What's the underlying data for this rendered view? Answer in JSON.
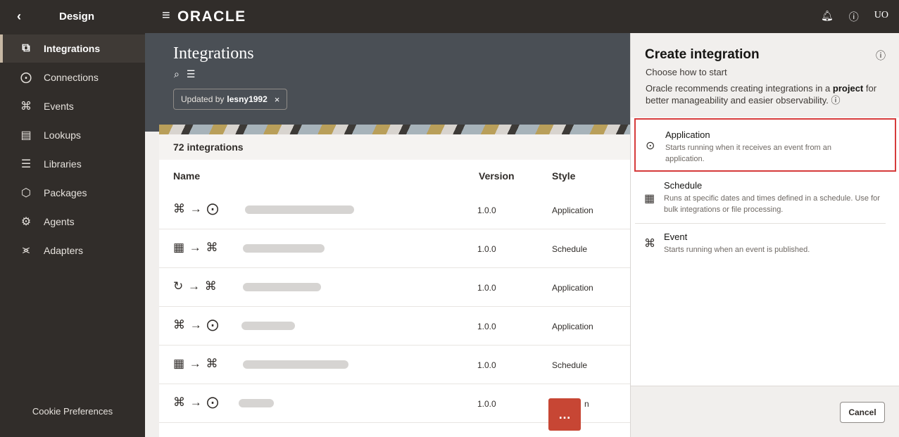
{
  "topbar": {
    "back_icon": "chevron-left-icon",
    "section_title": "Design",
    "brand": "ORACLE",
    "menu_icon": "hamburger-icon",
    "bell_icon": "bell-icon",
    "help_icon": "help-circle-icon",
    "user_initials": "UO"
  },
  "sidebar": {
    "items": [
      {
        "label": "Integrations",
        "icon": "integrations-icon"
      },
      {
        "label": "Connections",
        "icon": "connections-icon"
      },
      {
        "label": "Events",
        "icon": "events-icon"
      },
      {
        "label": "Lookups",
        "icon": "lookups-icon"
      },
      {
        "label": "Libraries",
        "icon": "libraries-icon"
      },
      {
        "label": "Packages",
        "icon": "packages-icon"
      },
      {
        "label": "Agents",
        "icon": "agents-icon"
      },
      {
        "label": "Adapters",
        "icon": "adapters-icon"
      }
    ],
    "cookie_label": "Cookie Preferences"
  },
  "main": {
    "title": "Integrations",
    "filter_chip": {
      "prefix": "Updated by",
      "value": "lesny1992",
      "close": "×"
    },
    "count_label": "72 integrations",
    "columns": {
      "name": "Name",
      "version": "Version",
      "style": "Style"
    },
    "rows": [
      {
        "version": "1.0.0",
        "style": "Application"
      },
      {
        "version": "1.0.0",
        "style": "Schedule"
      },
      {
        "version": "1.0.0",
        "style": "Application"
      },
      {
        "version": "1.0.0",
        "style": "Application"
      },
      {
        "version": "1.0.0",
        "style": "Schedule"
      },
      {
        "version": "1.0.0",
        "style": "n"
      }
    ]
  },
  "drawer": {
    "title": "Create integration",
    "subtitle": "Choose how to start",
    "recommendation_pre": "Oracle recommends creating integrations in a",
    "recommendation_bold": "project",
    "recommendation_post": "for better manageability and easier observability.",
    "options": [
      {
        "title": "Application",
        "description": "Starts running when it receives an event from an application.",
        "icon": "application-trigger-icon"
      },
      {
        "title": "Schedule",
        "description": "Runs at specific dates and times defined in a schedule. Use for bulk integrations or file processing.",
        "icon": "calendar-icon"
      },
      {
        "title": "Event",
        "description": "Starts running when an event is published.",
        "icon": "event-icon"
      }
    ],
    "cancel_label": "Cancel"
  },
  "colors": {
    "header_bg": "#312d2a",
    "hero_bg": "#4a4f55",
    "highlight_border": "#d63b3b",
    "chat_button": "#c74634"
  }
}
